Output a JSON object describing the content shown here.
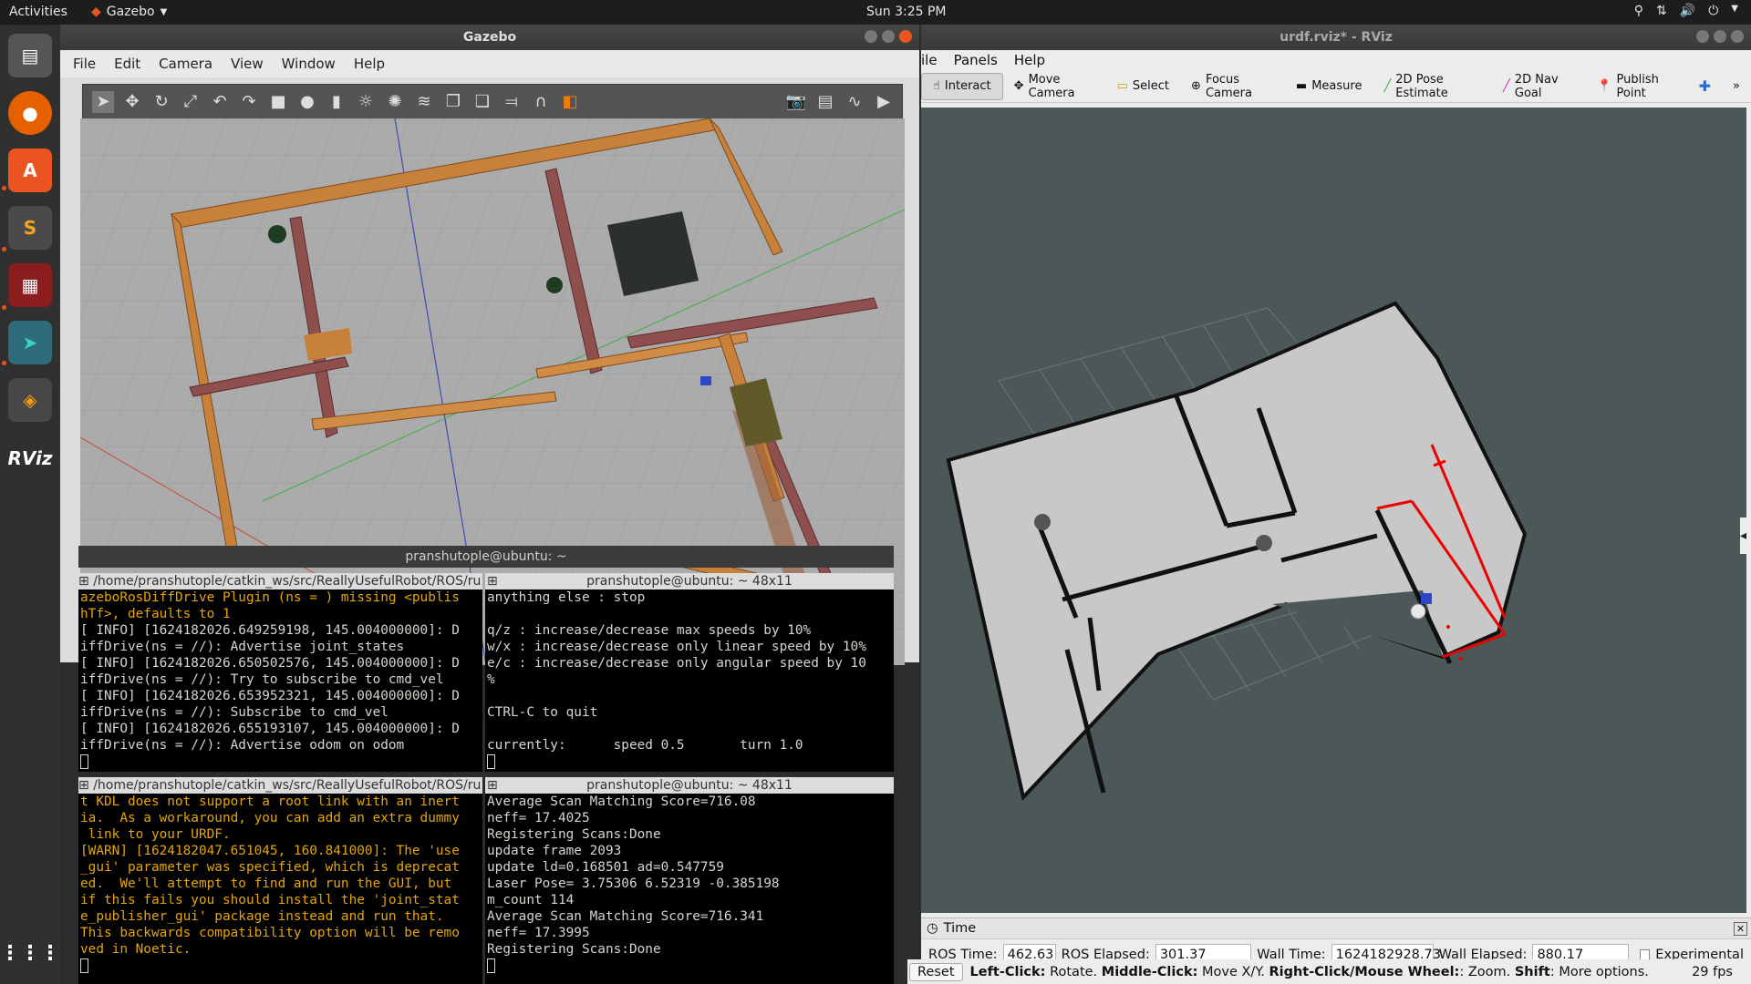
{
  "topbar": {
    "activities": "Activities",
    "app_name": "Gazebo",
    "clock": "Sun  3:25 PM"
  },
  "gazebo": {
    "title": "Gazebo",
    "menu": [
      "File",
      "Edit",
      "Camera",
      "View",
      "Window",
      "Help"
    ]
  },
  "terminal_window_title": "pranshutople@ubuntu: ~",
  "terminals": [
    {
      "tab": "/home/pranshutople/catkin_ws/src/ReallyUsefulRobot/ROS/ru",
      "lines": [
        {
          "t": "azeboRosDiffDrive Plugin (ns = ) missing <publis",
          "c": "orange"
        },
        {
          "t": "hTf>, defaults to 1",
          "c": "orange"
        },
        {
          "t": "[ INFO] [1624182026.649259198, 145.004000000]: D",
          "c": "white"
        },
        {
          "t": "iffDrive(ns = //): Advertise joint_states",
          "c": "white"
        },
        {
          "t": "[ INFO] [1624182026.650502576, 145.004000000]: D",
          "c": "white"
        },
        {
          "t": "iffDrive(ns = //): Try to subscribe to cmd_vel",
          "c": "white"
        },
        {
          "t": "[ INFO] [1624182026.653952321, 145.004000000]: D",
          "c": "white"
        },
        {
          "t": "iffDrive(ns = //): Subscribe to cmd_vel",
          "c": "white"
        },
        {
          "t": "[ INFO] [1624182026.655193107, 145.004000000]: D",
          "c": "white"
        },
        {
          "t": "iffDrive(ns = //): Advertise odom on odom",
          "c": "white"
        }
      ]
    },
    {
      "tab": "pranshutople@ubuntu: ~ 48x11",
      "lines": [
        {
          "t": "anything else : stop",
          "c": "white"
        },
        {
          "t": "",
          "c": "white"
        },
        {
          "t": "q/z : increase/decrease max speeds by 10%",
          "c": "white"
        },
        {
          "t": "w/x : increase/decrease only linear speed by 10%",
          "c": "white"
        },
        {
          "t": "e/c : increase/decrease only angular speed by 10",
          "c": "white"
        },
        {
          "t": "%",
          "c": "white"
        },
        {
          "t": "",
          "c": "white"
        },
        {
          "t": "CTRL-C to quit",
          "c": "white"
        },
        {
          "t": "",
          "c": "white"
        },
        {
          "t": "currently:      speed 0.5       turn 1.0",
          "c": "white"
        }
      ]
    },
    {
      "tab": "/home/pranshutople/catkin_ws/src/ReallyUsefulRobot/ROS/ru",
      "lines": [
        {
          "t": "t KDL does not support a root link with an inert",
          "c": "orange"
        },
        {
          "t": "ia.  As a workaround, you can add an extra dummy",
          "c": "orange"
        },
        {
          "t": " link to your URDF.",
          "c": "orange"
        },
        {
          "t": "[WARN] [1624182047.651045, 160.841000]: The 'use",
          "c": "orange"
        },
        {
          "t": "_gui' parameter was specified, which is deprecat",
          "c": "orange"
        },
        {
          "t": "ed.  We'll attempt to find and run the GUI, but",
          "c": "orange"
        },
        {
          "t": "if this fails you should install the 'joint_stat",
          "c": "orange"
        },
        {
          "t": "e_publisher_gui' package instead and run that.",
          "c": "orange"
        },
        {
          "t": "This backwards compatibility option will be remo",
          "c": "orange"
        },
        {
          "t": "ved in Noetic.",
          "c": "orange"
        }
      ]
    },
    {
      "tab": "pranshutople@ubuntu: ~ 48x11",
      "lines": [
        {
          "t": "Average Scan Matching Score=716.08",
          "c": "white"
        },
        {
          "t": "neff= 17.4025",
          "c": "white"
        },
        {
          "t": "Registering Scans:Done",
          "c": "white"
        },
        {
          "t": "update frame 2093",
          "c": "white"
        },
        {
          "t": "update ld=0.168501 ad=0.547759",
          "c": "white"
        },
        {
          "t": "Laser Pose= 3.75306 6.52319 -0.385198",
          "c": "white"
        },
        {
          "t": "m_count 114",
          "c": "white"
        },
        {
          "t": "Average Scan Matching Score=716.341",
          "c": "white"
        },
        {
          "t": "neff= 17.3995",
          "c": "white"
        },
        {
          "t": "Registering Scans:Done",
          "c": "white"
        }
      ]
    }
  ],
  "rviz": {
    "title": "urdf.rviz* - RViz",
    "menu": [
      "ile",
      "Panels",
      "Help"
    ],
    "tools": [
      {
        "label": "Interact",
        "icon": "hand-icon"
      },
      {
        "label": "Move Camera",
        "icon": "move-camera-icon"
      },
      {
        "label": "Select",
        "icon": "select-icon"
      },
      {
        "label": "Focus Camera",
        "icon": "focus-camera-icon"
      },
      {
        "label": "Measure",
        "icon": "measure-icon"
      },
      {
        "label": "2D Pose Estimate",
        "icon": "pose-estimate-icon"
      },
      {
        "label": "2D Nav Goal",
        "icon": "nav-goal-icon"
      },
      {
        "label": "Publish Point",
        "icon": "publish-point-icon"
      }
    ],
    "time_panel": {
      "title": "Time",
      "ros_time_label": "ROS Time:",
      "ros_time": "462.63",
      "ros_elapsed_label": "ROS Elapsed:",
      "ros_elapsed": "301.37",
      "wall_time_label": "Wall Time:",
      "wall_time": "1624182928.73",
      "wall_elapsed_label": "Wall Elapsed:",
      "wall_elapsed": "880.17",
      "experimental": "Experimental",
      "reset": "Reset",
      "hint_b1": "Left-Click:",
      "hint_t1": " Rotate. ",
      "hint_b2": "Middle-Click:",
      "hint_t2": " Move X/Y. ",
      "hint_b3": "Right-Click/Mouse Wheel:",
      "hint_t3": ": Zoom. ",
      "hint_b4": "Shift",
      "hint_t4": ": More options.",
      "fps": "29 fps"
    }
  },
  "colors": {
    "ubuntu_orange": "#e95420",
    "term_orange": "#e5a50a",
    "rviz_bg": "#4c5858"
  }
}
